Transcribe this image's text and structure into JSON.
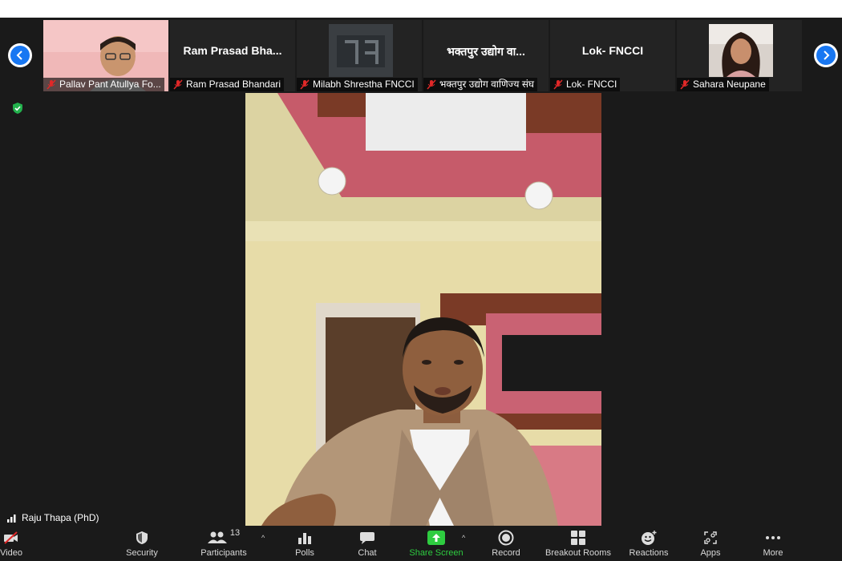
{
  "thumbnails": [
    {
      "label": "Pallav Pant Atullya Fo...",
      "big": ""
    },
    {
      "label": "Ram Prasad Bhandari",
      "big": "Ram Prasad Bha..."
    },
    {
      "label": "Milabh Shrestha FNCCI",
      "big": ""
    },
    {
      "label": "भक्तपुर उद्योग वाणिज्य संघ",
      "big": "भक्तपुर उद्योग वा..."
    },
    {
      "label": "Lok- FNCCI",
      "big": "Lok- FNCCI"
    },
    {
      "label": "Sahara Neupane",
      "big": ""
    }
  ],
  "speaker": {
    "name": "Raju Thapa (PhD)"
  },
  "toolbar": {
    "video": "Video",
    "security": "Security",
    "participants": "Participants",
    "participants_count": "13",
    "polls": "Polls",
    "chat": "Chat",
    "share_screen": "Share Screen",
    "record": "Record",
    "breakout_rooms": "Breakout Rooms",
    "reactions": "Reactions",
    "apps": "Apps",
    "more": "More"
  },
  "colors": {
    "accent": "#1877f2",
    "share_green": "#2ecc40",
    "mute_red": "#e02828",
    "bg": "#1a1a1a"
  }
}
